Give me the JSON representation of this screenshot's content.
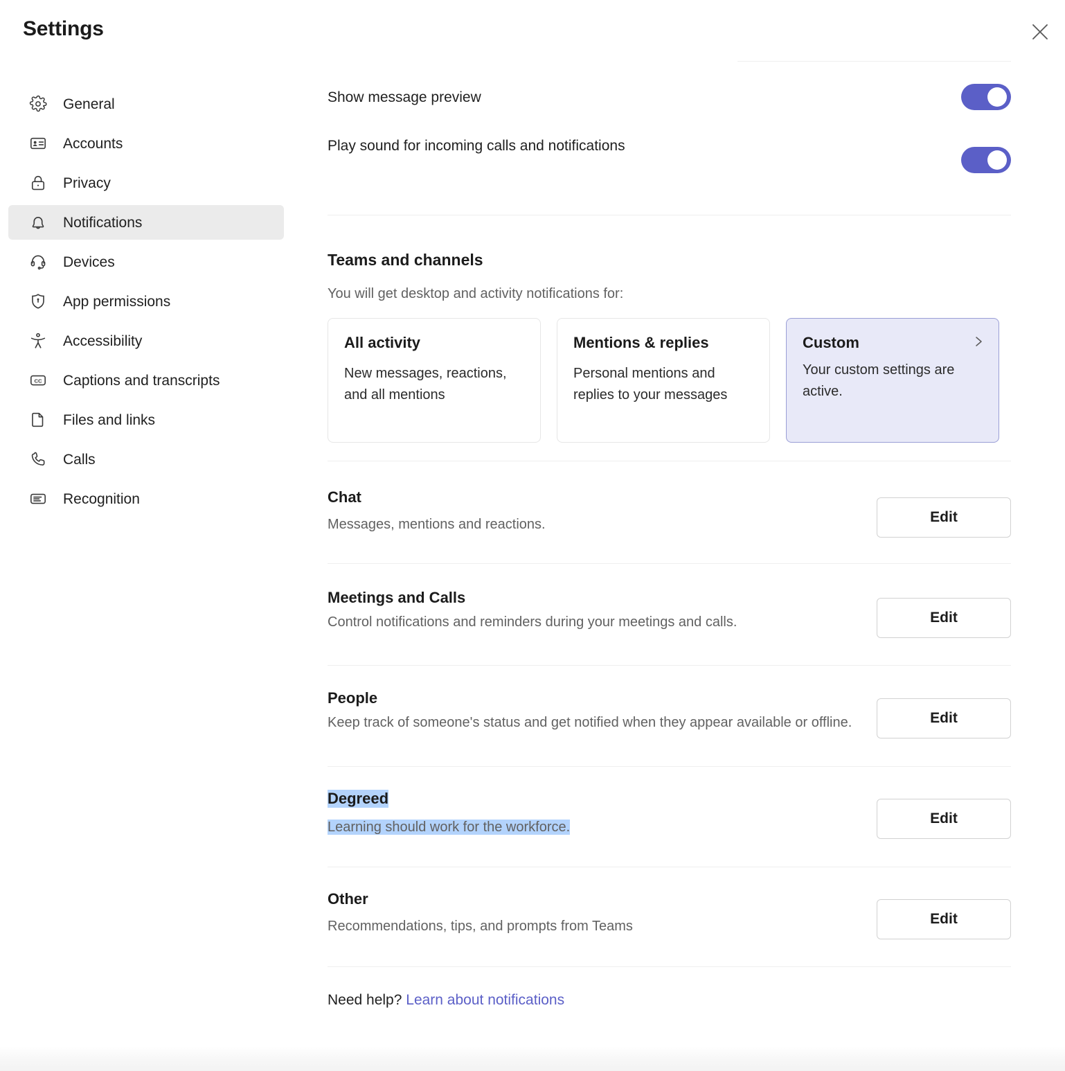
{
  "window": {
    "title": "Settings",
    "close_icon": "close-icon"
  },
  "sidebar": {
    "items": [
      {
        "label": "General",
        "icon": "gear-icon"
      },
      {
        "label": "Accounts",
        "icon": "id-card-icon"
      },
      {
        "label": "Privacy",
        "icon": "lock-icon"
      },
      {
        "label": "Notifications",
        "icon": "bell-icon"
      },
      {
        "label": "Devices",
        "icon": "headset-icon"
      },
      {
        "label": "App permissions",
        "icon": "shield-icon"
      },
      {
        "label": "Accessibility",
        "icon": "accessibility-icon"
      },
      {
        "label": "Captions and transcripts",
        "icon": "closed-caption-icon"
      },
      {
        "label": "Files and links",
        "icon": "file-icon"
      },
      {
        "label": "Calls",
        "icon": "phone-icon"
      },
      {
        "label": "Recognition",
        "icon": "badge-icon"
      }
    ],
    "selected": "Notifications"
  },
  "toggles": [
    {
      "label": "Show message preview",
      "state": "on"
    },
    {
      "label": "Play sound for incoming calls and notifications",
      "state": "on"
    }
  ],
  "teams_and_channels": {
    "heading": "Teams and channels",
    "subtext": "You will get desktop and activity notifications for:",
    "cards": [
      {
        "title": "All activity",
        "desc": "New messages, reactions, and all mentions",
        "selected": false
      },
      {
        "title": "Mentions & replies",
        "desc": "Personal mentions and replies to your messages",
        "selected": false
      },
      {
        "title": "Custom",
        "desc": "Your custom settings are active.",
        "selected": true,
        "chevron_icon": "chevron-right-icon"
      }
    ]
  },
  "sections": [
    {
      "title": "Chat",
      "desc": "Messages, mentions and reactions.",
      "button": "Edit",
      "highlighted": false
    },
    {
      "title": "Meetings and Calls",
      "desc": "Control notifications and reminders during your meetings and calls.",
      "button": "Edit",
      "highlighted": false
    },
    {
      "title": "People",
      "desc": "Keep track of someone's status and get notified when they appear available or offline.",
      "button": "Edit",
      "highlighted": false
    },
    {
      "title": "Degreed",
      "desc": "Learning should work for the workforce.",
      "button": "Edit",
      "highlighted": true
    },
    {
      "title": "Other",
      "desc": "Recommendations, tips, and prompts from Teams",
      "button": "Edit",
      "highlighted": false
    }
  ],
  "help": {
    "prefix": "Need help?",
    "link": "Learn about notifications"
  },
  "colors": {
    "accent": "#5b5fc7",
    "selected_card_bg": "#e8e9f8",
    "selected_card_border": "#9a9ed6",
    "selected_nav_bg": "#ebebeb",
    "text_selection": "#b3d3fc",
    "divider": "#efefef",
    "muted_text": "#616161"
  }
}
